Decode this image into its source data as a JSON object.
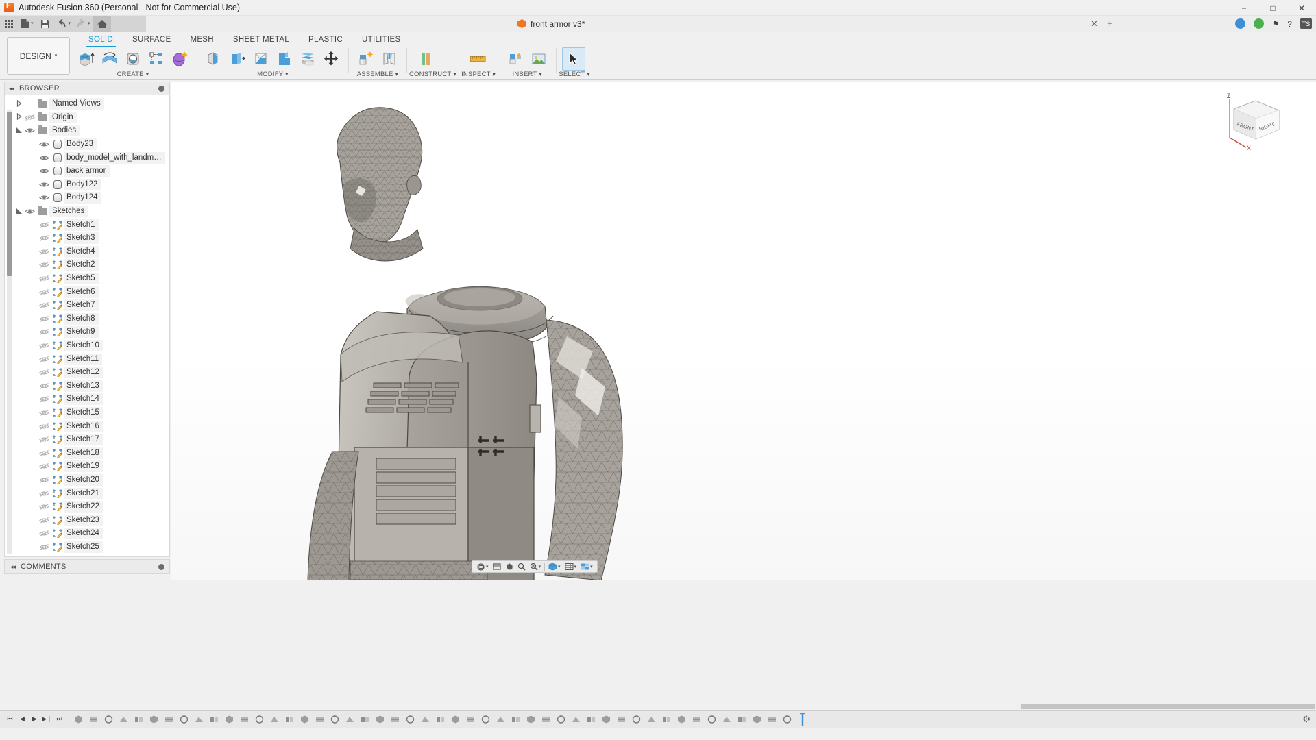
{
  "window": {
    "title": "Autodesk Fusion 360 (Personal - Not for Commercial Use)",
    "app_icon": "fusion-app-icon",
    "minimize": "−",
    "maximize": "□",
    "close": "✕"
  },
  "quick_access": {
    "items": [
      {
        "name": "app-grid-button",
        "icon": "grid-icon",
        "label": ""
      },
      {
        "name": "new-file-button",
        "icon": "file-icon",
        "label": "",
        "caret": "▾"
      },
      {
        "name": "save-button",
        "icon": "save-icon",
        "label": ""
      },
      {
        "name": "undo-button",
        "icon": "undo-arrow-icon",
        "label": "",
        "caret": "▾"
      },
      {
        "name": "redo-button",
        "icon": "redo-arrow-icon",
        "label": "",
        "caret": "▾"
      },
      {
        "name": "home-button",
        "icon": "home-icon",
        "label": ""
      }
    ]
  },
  "document_tab": {
    "title": "front armor v3*",
    "icon": "orange-cube-icon",
    "close_label": "✕",
    "add_tab_label": "+"
  },
  "top_right": {
    "items": [
      {
        "name": "extensions-icon",
        "color": "#3d8fd6"
      },
      {
        "name": "job-status-icon",
        "color": "#4caf50"
      },
      {
        "name": "notifications-icon",
        "glyph": "⚑"
      },
      {
        "name": "help-icon",
        "glyph": "?"
      },
      {
        "name": "account-avatar",
        "label": "TS"
      }
    ]
  },
  "ribbon": {
    "workspace_selector": {
      "label": "DESIGN",
      "caret": "▾"
    },
    "tabs": [
      {
        "label": "SOLID",
        "active": true
      },
      {
        "label": "SURFACE",
        "active": false
      },
      {
        "label": "MESH",
        "active": false
      },
      {
        "label": "SHEET METAL",
        "active": false
      },
      {
        "label": "PLASTIC",
        "active": false
      },
      {
        "label": "UTILITIES",
        "active": false
      }
    ],
    "panels": [
      {
        "label": "CREATE ▾",
        "name": "panel-create",
        "tools": [
          {
            "name": "extrude-tool",
            "icon": "extrude-icon"
          },
          {
            "name": "revolve-tool",
            "icon": "revolve-icon"
          },
          {
            "name": "hole-tool",
            "icon": "hole-icon"
          },
          {
            "name": "rectangular-pattern-tool",
            "icon": "pattern-icon"
          },
          {
            "name": "form-tool",
            "icon": "form-sculpt-icon"
          }
        ]
      },
      {
        "label": "MODIFY ▾",
        "name": "panel-modify",
        "tools": [
          {
            "name": "fillet-tool",
            "icon": "fillet-icon"
          },
          {
            "name": "shell-tool",
            "icon": "shell-icon"
          },
          {
            "name": "draft-tool",
            "icon": "draft-icon"
          },
          {
            "name": "combine-tool",
            "icon": "combine-icon"
          },
          {
            "name": "split-face-tool",
            "icon": "split-icon"
          },
          {
            "name": "move-copy-tool",
            "icon": "move-arrows-icon"
          }
        ]
      },
      {
        "label": "ASSEMBLE ▾",
        "name": "panel-assemble",
        "tools": [
          {
            "name": "new-component-tool",
            "icon": "new-component-icon"
          },
          {
            "name": "joint-tool",
            "icon": "joint-icon"
          }
        ]
      },
      {
        "label": "CONSTRUCT ▾",
        "name": "panel-construct",
        "tools": [
          {
            "name": "offset-plane-tool",
            "icon": "offset-plane-icon"
          }
        ]
      },
      {
        "label": "INSPECT ▾",
        "name": "panel-inspect",
        "tools": [
          {
            "name": "measure-tool",
            "icon": "ruler-icon"
          }
        ]
      },
      {
        "label": "INSERT ▾",
        "name": "panel-insert",
        "tools": [
          {
            "name": "insert-derive-tool",
            "icon": "insert-derive-icon"
          },
          {
            "name": "insert-canvas-tool",
            "icon": "canvas-image-icon"
          }
        ]
      },
      {
        "label": "SELECT ▾",
        "name": "panel-select",
        "tools": [
          {
            "name": "select-tool",
            "icon": "cursor-arrow-icon",
            "selected": true
          }
        ]
      }
    ]
  },
  "browser": {
    "title": "BROWSER",
    "collapse_glyph": "◂◂",
    "pin_icon": "pin-dot-icon",
    "nodes": [
      {
        "label": "Named Views",
        "type": "folder",
        "indent": 1,
        "expander": "right",
        "eye": "none"
      },
      {
        "label": "Origin",
        "type": "folder",
        "indent": 1,
        "expander": "right",
        "eye": "hidden"
      },
      {
        "label": "Bodies",
        "type": "folder",
        "indent": 1,
        "expander": "down",
        "eye": "visible"
      },
      {
        "label": "Body23",
        "type": "body",
        "indent": 2,
        "expander": "none",
        "eye": "visible"
      },
      {
        "label": "body_model_with_landmarks.c…",
        "type": "body",
        "indent": 2,
        "expander": "none",
        "eye": "visible"
      },
      {
        "label": "back armor",
        "type": "body",
        "indent": 2,
        "expander": "none",
        "eye": "visible"
      },
      {
        "label": "Body122",
        "type": "body",
        "indent": 2,
        "expander": "none",
        "eye": "visible"
      },
      {
        "label": "Body124",
        "type": "body",
        "indent": 2,
        "expander": "none",
        "eye": "visible"
      },
      {
        "label": "Sketches",
        "type": "folder",
        "indent": 1,
        "expander": "down",
        "eye": "visible"
      },
      {
        "label": "Sketch1",
        "type": "sketch",
        "indent": 2,
        "expander": "none",
        "eye": "hidden"
      },
      {
        "label": "Sketch3",
        "type": "sketch",
        "indent": 2,
        "expander": "none",
        "eye": "hidden"
      },
      {
        "label": "Sketch4",
        "type": "sketch",
        "indent": 2,
        "expander": "none",
        "eye": "hidden"
      },
      {
        "label": "Sketch2",
        "type": "sketch",
        "indent": 2,
        "expander": "none",
        "eye": "hidden"
      },
      {
        "label": "Sketch5",
        "type": "sketch",
        "indent": 2,
        "expander": "none",
        "eye": "hidden"
      },
      {
        "label": "Sketch6",
        "type": "sketch",
        "indent": 2,
        "expander": "none",
        "eye": "hidden"
      },
      {
        "label": "Sketch7",
        "type": "sketch",
        "indent": 2,
        "expander": "none",
        "eye": "hidden"
      },
      {
        "label": "Sketch8",
        "type": "sketch",
        "indent": 2,
        "expander": "none",
        "eye": "hidden"
      },
      {
        "label": "Sketch9",
        "type": "sketch",
        "indent": 2,
        "expander": "none",
        "eye": "hidden"
      },
      {
        "label": "Sketch10",
        "type": "sketch",
        "indent": 2,
        "expander": "none",
        "eye": "hidden"
      },
      {
        "label": "Sketch11",
        "type": "sketch",
        "indent": 2,
        "expander": "none",
        "eye": "hidden"
      },
      {
        "label": "Sketch12",
        "type": "sketch",
        "indent": 2,
        "expander": "none",
        "eye": "hidden"
      },
      {
        "label": "Sketch13",
        "type": "sketch",
        "indent": 2,
        "expander": "none",
        "eye": "hidden"
      },
      {
        "label": "Sketch14",
        "type": "sketch",
        "indent": 2,
        "expander": "none",
        "eye": "hidden"
      },
      {
        "label": "Sketch15",
        "type": "sketch",
        "indent": 2,
        "expander": "none",
        "eye": "hidden"
      },
      {
        "label": "Sketch16",
        "type": "sketch",
        "indent": 2,
        "expander": "none",
        "eye": "hidden"
      },
      {
        "label": "Sketch17",
        "type": "sketch",
        "indent": 2,
        "expander": "none",
        "eye": "hidden"
      },
      {
        "label": "Sketch18",
        "type": "sketch",
        "indent": 2,
        "expander": "none",
        "eye": "hidden"
      },
      {
        "label": "Sketch19",
        "type": "sketch",
        "indent": 2,
        "expander": "none",
        "eye": "hidden"
      },
      {
        "label": "Sketch20",
        "type": "sketch",
        "indent": 2,
        "expander": "none",
        "eye": "hidden"
      },
      {
        "label": "Sketch21",
        "type": "sketch",
        "indent": 2,
        "expander": "none",
        "eye": "hidden"
      },
      {
        "label": "Sketch22",
        "type": "sketch",
        "indent": 2,
        "expander": "none",
        "eye": "hidden"
      },
      {
        "label": "Sketch23",
        "type": "sketch",
        "indent": 2,
        "expander": "none",
        "eye": "hidden"
      },
      {
        "label": "Sketch24",
        "type": "sketch",
        "indent": 2,
        "expander": "none",
        "eye": "hidden"
      },
      {
        "label": "Sketch25",
        "type": "sketch",
        "indent": 2,
        "expander": "none",
        "eye": "hidden"
      }
    ]
  },
  "comments": {
    "title": "COMMENTS",
    "pin_icon": "pin-dot-icon"
  },
  "viewcube": {
    "axis_label_z": "Z",
    "axis_label_x": "X",
    "face_front": "FRONT",
    "face_right": "RIGHT"
  },
  "nav_bar": {
    "items": [
      {
        "name": "orbit-button",
        "icon": "orbit-icon",
        "caret": "▾"
      },
      {
        "name": "look-at-button",
        "icon": "look-at-icon"
      },
      {
        "name": "pan-button",
        "icon": "hand-pan-icon"
      },
      {
        "name": "zoom-button",
        "icon": "magnifier-icon"
      },
      {
        "name": "zoom-window-button",
        "icon": "zoom-window-icon",
        "caret": "▾"
      },
      {
        "name": "display-settings-button",
        "icon": "display-settings-icon",
        "caret": "▾"
      },
      {
        "name": "grid-snaps-button",
        "icon": "grid-snap-icon",
        "caret": "▾"
      },
      {
        "name": "viewports-button",
        "icon": "viewports-icon",
        "caret": "▾"
      }
    ]
  },
  "timeline": {
    "playback": [
      {
        "name": "timeline-jump-start",
        "glyph": "⏮"
      },
      {
        "name": "timeline-step-back",
        "glyph": "◀"
      },
      {
        "name": "timeline-play",
        "glyph": "▶"
      },
      {
        "name": "timeline-step-forward",
        "glyph": "▶❘"
      },
      {
        "name": "timeline-jump-end",
        "glyph": "⏭"
      }
    ],
    "feature_count": 48,
    "settings_icon": "gear-icon",
    "end_marker": "timeline-end-marker"
  }
}
